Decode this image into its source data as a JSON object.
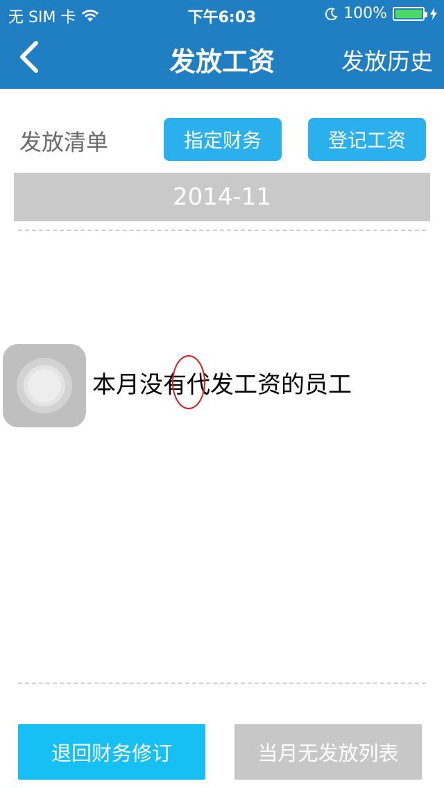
{
  "status_bar": {
    "carrier": "无 SIM 卡",
    "time": "下午6:03",
    "battery": "100%",
    "icons": [
      "wifi-icon",
      "moon-icon",
      "battery-icon",
      "charging-bolt-icon"
    ]
  },
  "nav": {
    "title": "发放工资",
    "right_action": "发放历史",
    "back_icon": "chevron-left-icon"
  },
  "content": {
    "list_label": "发放清单",
    "assign_button": "指定财务",
    "register_button": "登记工资",
    "month": "2014-11",
    "empty_message": "本月没有代发工资的员工"
  },
  "footer": {
    "return_button": "退回财务修订",
    "none_button": "当月无发放列表"
  },
  "colors": {
    "nav_bg": "#1f7fc2",
    "button_blue": "#2bb0ee",
    "return_button": "#16c0f5",
    "disabled_gray": "#c7c7c7",
    "annotation_red": "#e01818"
  }
}
